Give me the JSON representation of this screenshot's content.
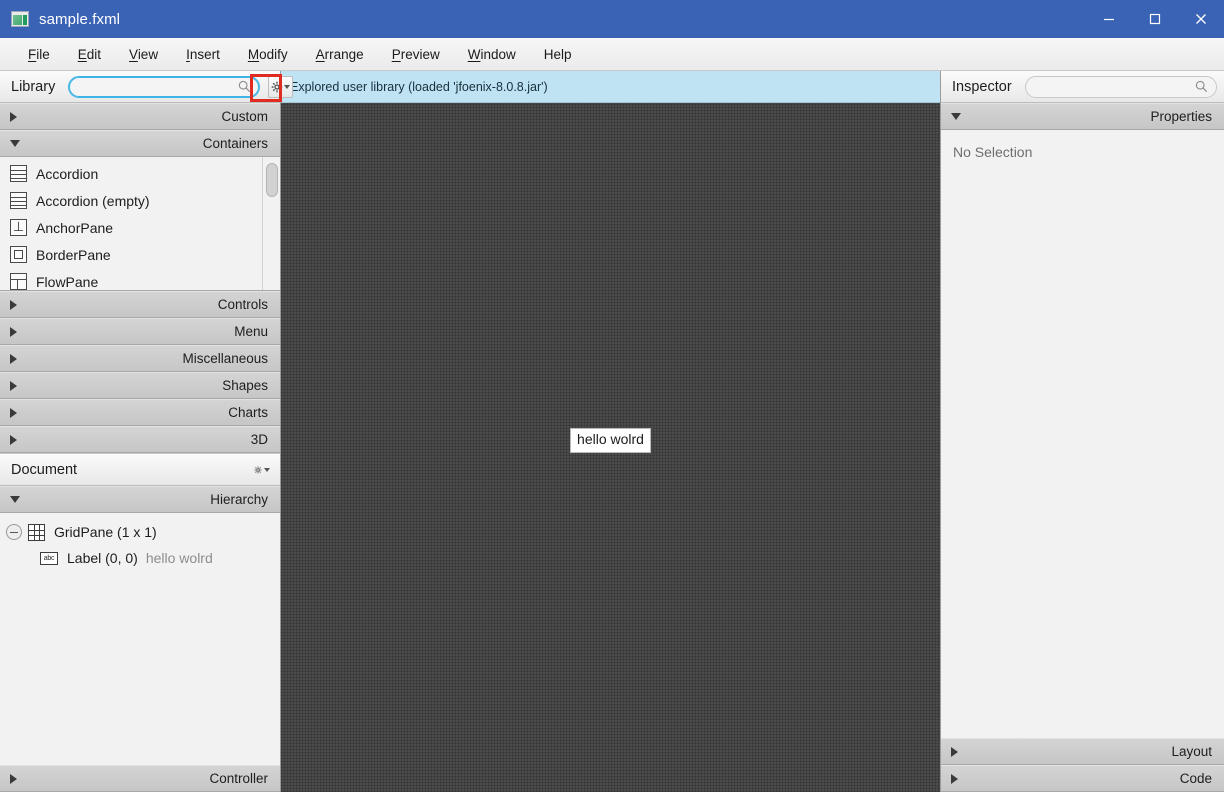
{
  "window": {
    "title": "sample.fxml",
    "icon": "fxml-document-icon",
    "controls": {
      "minimize": "minimize-icon",
      "maximize": "maximize-icon",
      "close": "close-icon"
    },
    "titlebar_color": "#3b63b5"
  },
  "menubar": {
    "items": [
      {
        "label": "File",
        "mnemonic": "F"
      },
      {
        "label": "Edit",
        "mnemonic": "E"
      },
      {
        "label": "View",
        "mnemonic": "V"
      },
      {
        "label": "Insert",
        "mnemonic": "I"
      },
      {
        "label": "Modify",
        "mnemonic": "M"
      },
      {
        "label": "Arrange",
        "mnemonic": "A"
      },
      {
        "label": "Preview",
        "mnemonic": "P"
      },
      {
        "label": "Window",
        "mnemonic": "W"
      },
      {
        "label": "Help",
        "mnemonic": ""
      }
    ]
  },
  "library": {
    "title": "Library",
    "search": {
      "value": "",
      "placeholder": ""
    },
    "gear_menu_label": "gear-icon",
    "highlight_color": "#e02b20",
    "sections": [
      {
        "label": "Custom",
        "expanded": false
      },
      {
        "label": "Containers",
        "expanded": true
      },
      {
        "label": "Controls",
        "expanded": false
      },
      {
        "label": "Menu",
        "expanded": false
      },
      {
        "label": "Miscellaneous",
        "expanded": false
      },
      {
        "label": "Shapes",
        "expanded": false
      },
      {
        "label": "Charts",
        "expanded": false
      },
      {
        "label": "3D",
        "expanded": false
      }
    ],
    "items": [
      {
        "label": "Accordion",
        "icon": "accordion-icon"
      },
      {
        "label": "Accordion  (empty)",
        "icon": "accordion-icon"
      },
      {
        "label": "AnchorPane",
        "icon": "anchorpane-icon"
      },
      {
        "label": "BorderPane",
        "icon": "borderpane-icon"
      },
      {
        "label": "FlowPane",
        "icon": "flowpane-icon"
      }
    ]
  },
  "document": {
    "title": "Document",
    "gear_menu_label": "gear-icon",
    "hierarchy": {
      "label": "Hierarchy",
      "expanded": true,
      "nodes": [
        {
          "label": "GridPane (1 x 1)",
          "detail": "",
          "icon": "gridpane-icon",
          "depth": 0,
          "expander": "collapse"
        },
        {
          "label": "Label (0, 0)",
          "detail": "hello wolrd",
          "icon": "label-abc-icon",
          "depth": 1,
          "expander": "none"
        }
      ]
    },
    "controller": {
      "label": "Controller",
      "expanded": false
    }
  },
  "statusbar": {
    "message": "Explored user library (loaded 'jfoenix-8.0.8.jar')",
    "background": "#bfe3f3"
  },
  "canvas": {
    "background": "#4b4b4b",
    "nodes": [
      {
        "type": "Label",
        "text": "hello wolrd"
      }
    ]
  },
  "inspector": {
    "title": "Inspector",
    "search": {
      "value": "",
      "placeholder": ""
    },
    "gear_menu_label": "gear-icon",
    "properties": {
      "label": "Properties",
      "expanded": true,
      "content": "No Selection"
    },
    "layout": {
      "label": "Layout",
      "expanded": false
    },
    "code": {
      "label": "Code",
      "expanded": false
    }
  }
}
